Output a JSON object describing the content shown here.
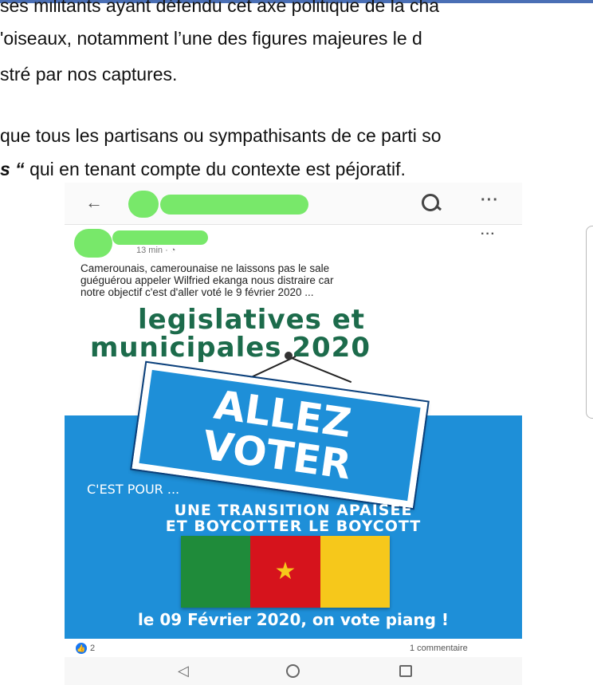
{
  "article": {
    "line1": "ses militants ayant défendu cet axe politique de la cha",
    "line2": "'oiseaux, notamment l’une des figures majeures le d",
    "line3": "stré par nos captures.",
    "line4": "que tous les partisans ou sympathisants de ce parti so",
    "line5_bold": "s “",
    "line5_rest": " qui en tenant compte du contexte est péjoratif."
  },
  "post": {
    "time": "13 min · ",
    "text_line1": "Camerounais, camerounaise ne laissons pas le sale",
    "text_line2": "guéguérou appeler Wilfried ekanga nous distraire car",
    "text_line3": "notre objectif c'est d'aller voté le 9 février 2020 ...",
    "likes": "2",
    "comments": "1 commentaire"
  },
  "poster": {
    "title1": "legislatives et",
    "title2": "municipales 2020",
    "sign_line1": "ALLEZ",
    "sign_line2": "VOTER",
    "intro": "C'EST POUR ...",
    "slogan1": "UNE TRANSITION APAISÉE",
    "slogan2": "ET BOYCOTTER LE BOYCOTT",
    "date": "le 09 Février 2020, on vote piang !"
  },
  "colors": {
    "accent_blue": "#1e8fd8",
    "title_green": "#1c6b4b",
    "redaction_green": "#78e86a",
    "flag_green": "#1f8b3a",
    "flag_red": "#d6131c",
    "flag_yellow": "#f6c81b"
  }
}
